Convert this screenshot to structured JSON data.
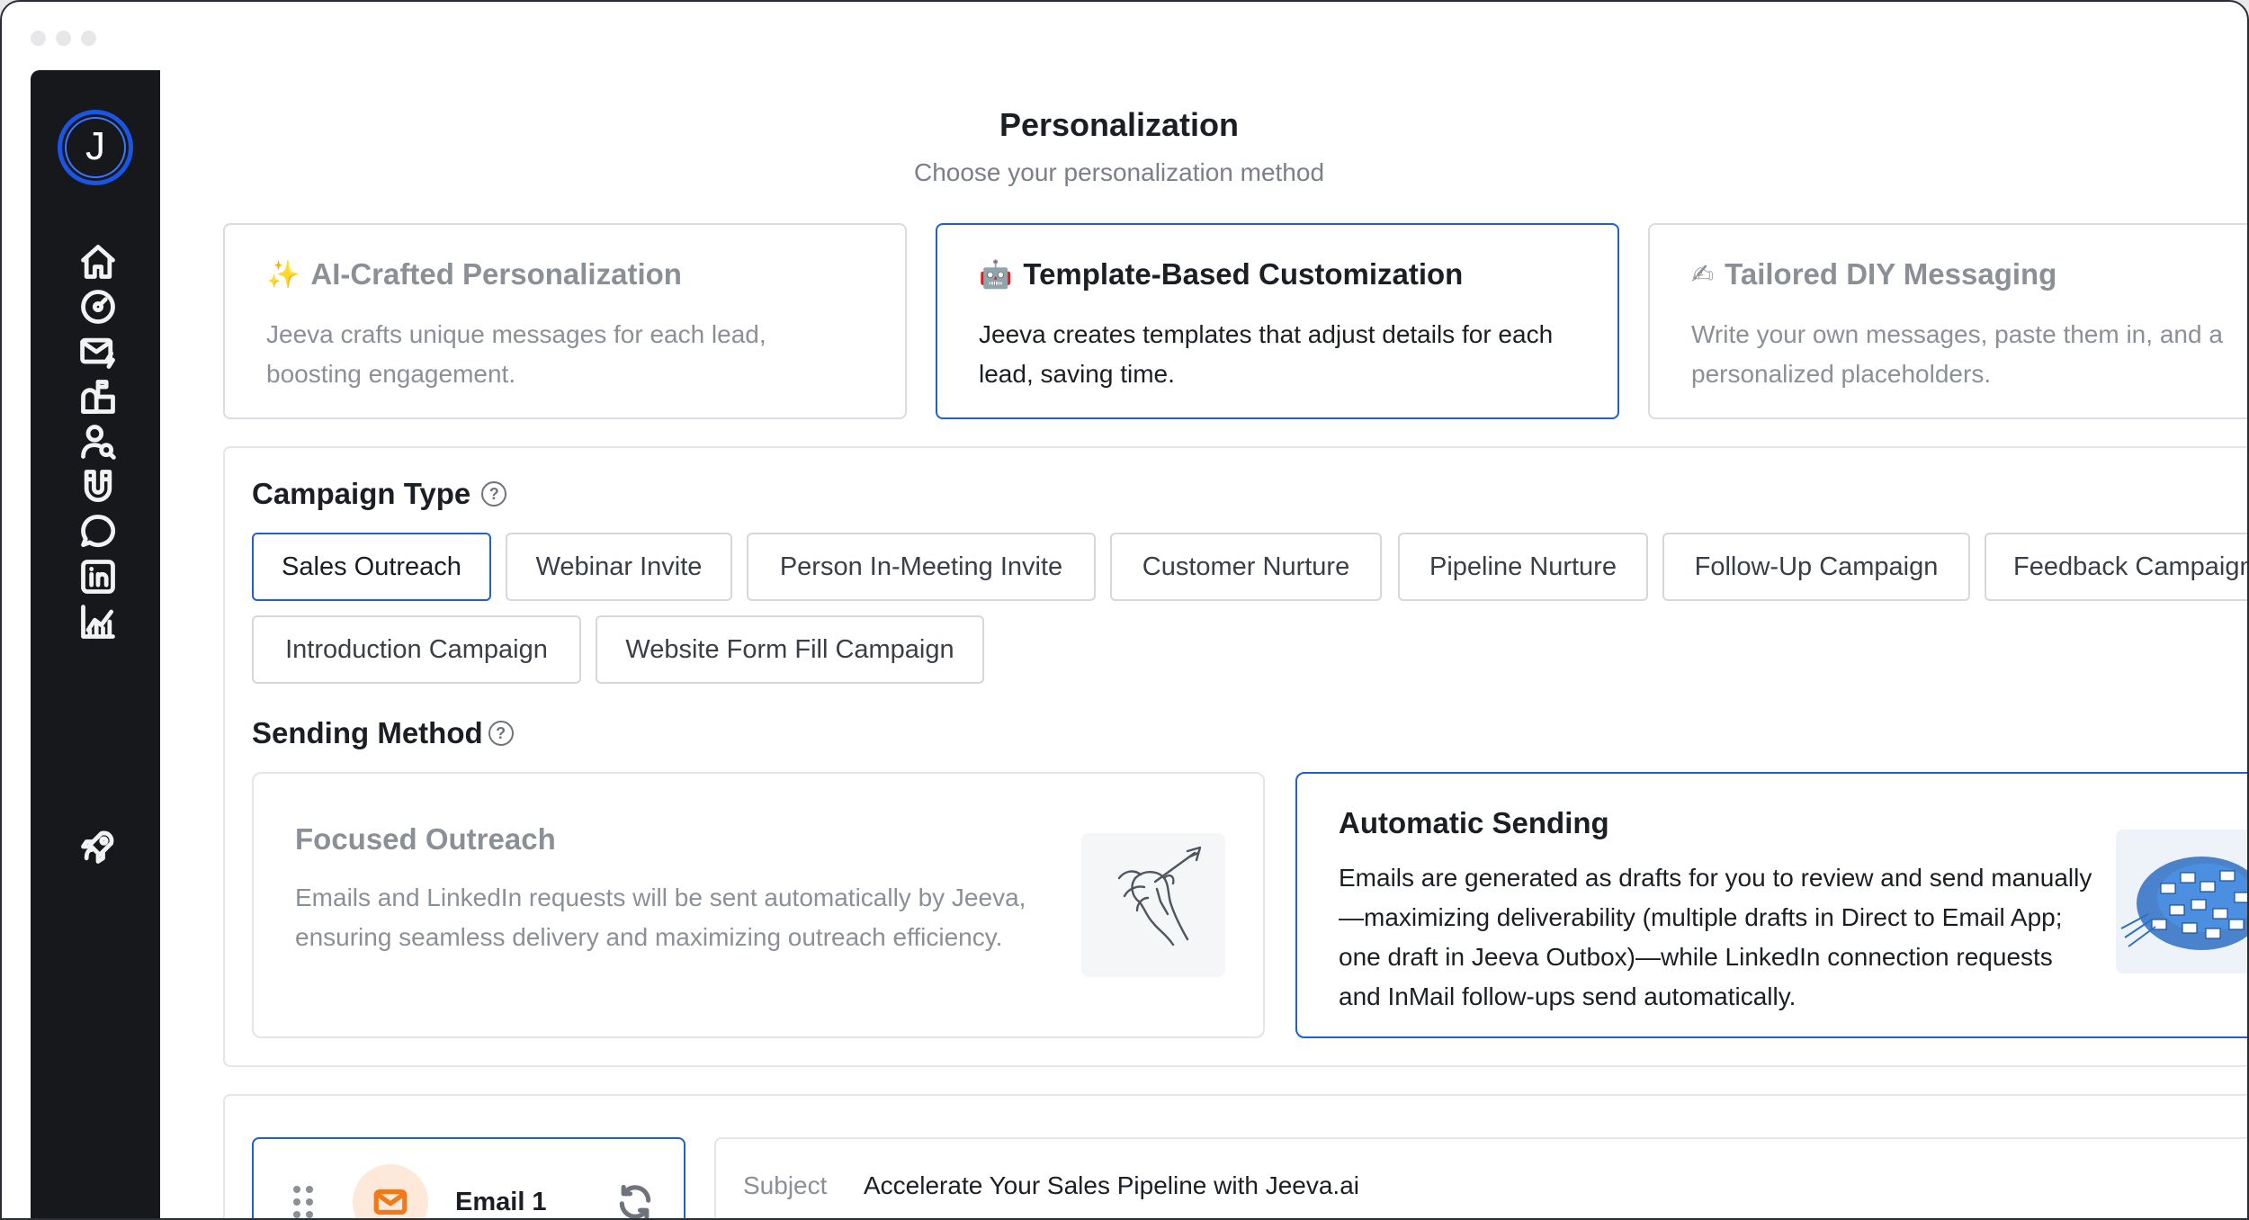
{
  "header": {
    "title": "Personalization",
    "subtitle": "Choose your personalization method"
  },
  "personalization_methods": [
    {
      "emoji": "✨",
      "title": "AI-Crafted Personalization",
      "description": "Jeeva crafts unique messages for each lead, boosting engagement.",
      "selected": false
    },
    {
      "emoji": "🤖",
      "title": "Template-Based Customization",
      "description": "Jeeva creates templates that adjust details for each lead, saving time.",
      "selected": true
    },
    {
      "emoji": "✍",
      "title": "Tailored DIY Messaging",
      "description": "Write your own messages, paste them in, and a personalized placeholders.",
      "selected": false
    }
  ],
  "campaign_type": {
    "label": "Campaign Type",
    "help": "?",
    "selected": "Sales Outreach",
    "options": [
      "Sales Outreach",
      "Webinar Invite",
      "Person In-Meeting Invite",
      "Customer Nurture",
      "Pipeline Nurture",
      "Follow-Up Campaign",
      "Feedback Campaign",
      "Introduction Campaign",
      "Website Form Fill Campaign"
    ]
  },
  "sending_method": {
    "label": "Sending Method",
    "help": "?",
    "options": [
      {
        "title": "Focused Outreach",
        "description": "Emails and LinkedIn requests will be sent automatically by Jeeva, ensuring seamless delivery and maximizing outreach efficiency.",
        "selected": false,
        "illustration": "hand-dart-illustration"
      },
      {
        "title": "Automatic Sending",
        "description": "Emails are generated as drafts for you to review and send manually—maximizing deliverability (multiple drafts in Direct to Email App; one draft in Jeeva Outbox)—while LinkedIn connection requests and InMail follow-ups send automatically.",
        "selected": true,
        "illustration": "email-swarm-illustration"
      }
    ]
  },
  "email_step": {
    "label": "Email 1",
    "icon": "mail-icon",
    "subject_label": "Subject",
    "subject_value": "Accelerate Your Sales Pipeline with Jeeva.ai"
  },
  "sidebar": {
    "logo_letter": "J",
    "items": [
      "home-icon",
      "dashboard-icon",
      "mail-bolt-icon",
      "mailbox-icon",
      "user-search-icon",
      "magnet-icon",
      "chat-icon",
      "linkedin-icon",
      "analytics-icon",
      "rocket-icon"
    ]
  },
  "colors": {
    "accent": "#1e5fd6",
    "sidebar_bg": "#16181c",
    "muted_text": "#8b9097",
    "email_icon": "#f07a1a"
  }
}
